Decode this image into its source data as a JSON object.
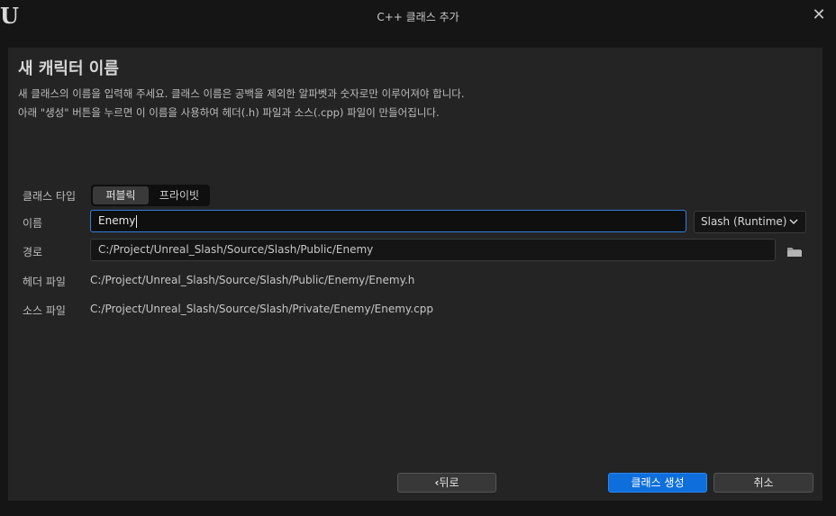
{
  "window": {
    "title": "C++ 클래스 추가",
    "logo_text": "U",
    "close_glyph": "✕"
  },
  "header": {
    "title": "새 캐릭터 이름",
    "description_line1": "새 클래스의 이름을 입력해 주세요. 클래스 이름은 공백을 제외한 알파벳과 숫자로만 이루어져야 합니다.",
    "description_line2": "아래 \"생성\" 버튼을 누르면 이 이름을 사용하여 헤더(.h) 파일과 소스(.cpp) 파일이 만들어집니다."
  },
  "form": {
    "class_type_label": "클래스 타입",
    "class_type_options": [
      "퍼블릭",
      "프라이빗"
    ],
    "class_type_selected": "퍼블릭",
    "name_label": "이름",
    "name_value": "Enemy",
    "module_value": "Slash (Runtime)",
    "path_label": "경로",
    "path_value": "C:/Project/Unreal_Slash/Source/Slash/Public/Enemy",
    "header_file_label": "헤더 파일",
    "header_file_value": "C:/Project/Unreal_Slash/Source/Slash/Public/Enemy/Enemy.h",
    "source_file_label": "소스 파일",
    "source_file_value": "C:/Project/Unreal_Slash/Source/Slash/Private/Enemy/Enemy.cpp"
  },
  "footer": {
    "back_label": "뒤로",
    "back_glyph": "‹",
    "create_label": "클래스 생성",
    "cancel_label": "취소"
  },
  "icons": {
    "folder": "folder-icon",
    "chevron": "chevron-down-icon",
    "close": "close-icon"
  },
  "colors": {
    "accent": "#0e6fdc",
    "focus_border": "#2f7fd8",
    "panel": "#242424",
    "background": "#151515"
  }
}
